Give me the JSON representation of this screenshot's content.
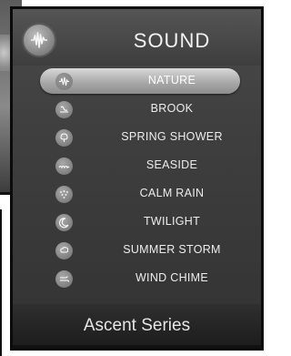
{
  "header": {
    "title": "SOUND",
    "icon": "sound-wave-icon"
  },
  "sounds": [
    {
      "label": "NATURE",
      "icon": "wave-icon",
      "selected": true
    },
    {
      "label": "BROOK",
      "icon": "brook-icon",
      "selected": false
    },
    {
      "label": "SPRING SHOWER",
      "icon": "shower-icon",
      "selected": false
    },
    {
      "label": "SEASIDE",
      "icon": "seaside-icon",
      "selected": false
    },
    {
      "label": "CALM RAIN",
      "icon": "rain-icon",
      "selected": false
    },
    {
      "label": "TWILIGHT",
      "icon": "moon-icon",
      "selected": false
    },
    {
      "label": "SUMMER STORM",
      "icon": "storm-icon",
      "selected": false
    },
    {
      "label": "WIND CHIME",
      "icon": "wind-chime-icon",
      "selected": false
    }
  ],
  "footer": {
    "series": "Ascent Series"
  },
  "colors": {
    "screen": "#3f3f3f",
    "selected_pill": "#b5b5b5",
    "text": "#ededed"
  }
}
